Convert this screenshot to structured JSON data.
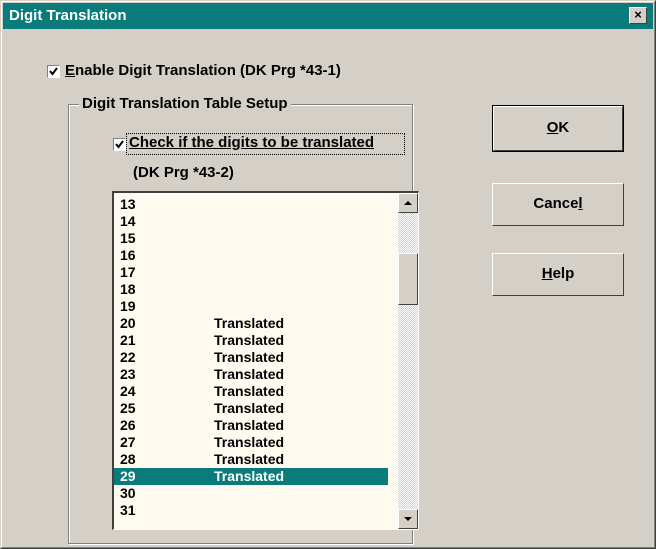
{
  "window": {
    "title": "Digit Translation",
    "close_glyph": "×"
  },
  "enable": {
    "checked": true,
    "label_accel": "E",
    "label_rest": "nable Digit Translation (DK Prg *43-1)"
  },
  "group": {
    "title": "Digit Translation Table Setup",
    "check_label": "Check if the digits to be translated",
    "check_checked": true,
    "sub_label": "(DK Prg *43-2)"
  },
  "list": {
    "rows": [
      {
        "num": "13",
        "status": ""
      },
      {
        "num": "14",
        "status": ""
      },
      {
        "num": "15",
        "status": ""
      },
      {
        "num": "16",
        "status": ""
      },
      {
        "num": "17",
        "status": ""
      },
      {
        "num": "18",
        "status": ""
      },
      {
        "num": "19",
        "status": ""
      },
      {
        "num": "20",
        "status": "Translated"
      },
      {
        "num": "21",
        "status": "Translated"
      },
      {
        "num": "22",
        "status": "Translated"
      },
      {
        "num": "23",
        "status": "Translated"
      },
      {
        "num": "24",
        "status": "Translated"
      },
      {
        "num": "25",
        "status": "Translated"
      },
      {
        "num": "26",
        "status": "Translated"
      },
      {
        "num": "27",
        "status": "Translated"
      },
      {
        "num": "28",
        "status": "Translated"
      },
      {
        "num": "29",
        "status": "Translated"
      },
      {
        "num": "30",
        "status": ""
      },
      {
        "num": "31",
        "status": ""
      }
    ],
    "selected_num": "29"
  },
  "buttons": {
    "ok_accel": "O",
    "ok_rest": "K",
    "cancel_pre": "Cance",
    "cancel_accel": "l",
    "help_accel": "H",
    "help_rest": "elp"
  },
  "icons": {
    "check": "check-icon",
    "scroll_up": "arrow-up-icon",
    "scroll_down": "arrow-down-icon",
    "close": "close-icon"
  },
  "colors": {
    "title_bar": "#0a7b7b",
    "selection": "#0a7b7b",
    "face": "#d4d0c8",
    "list_bg": "#fffaf0"
  }
}
